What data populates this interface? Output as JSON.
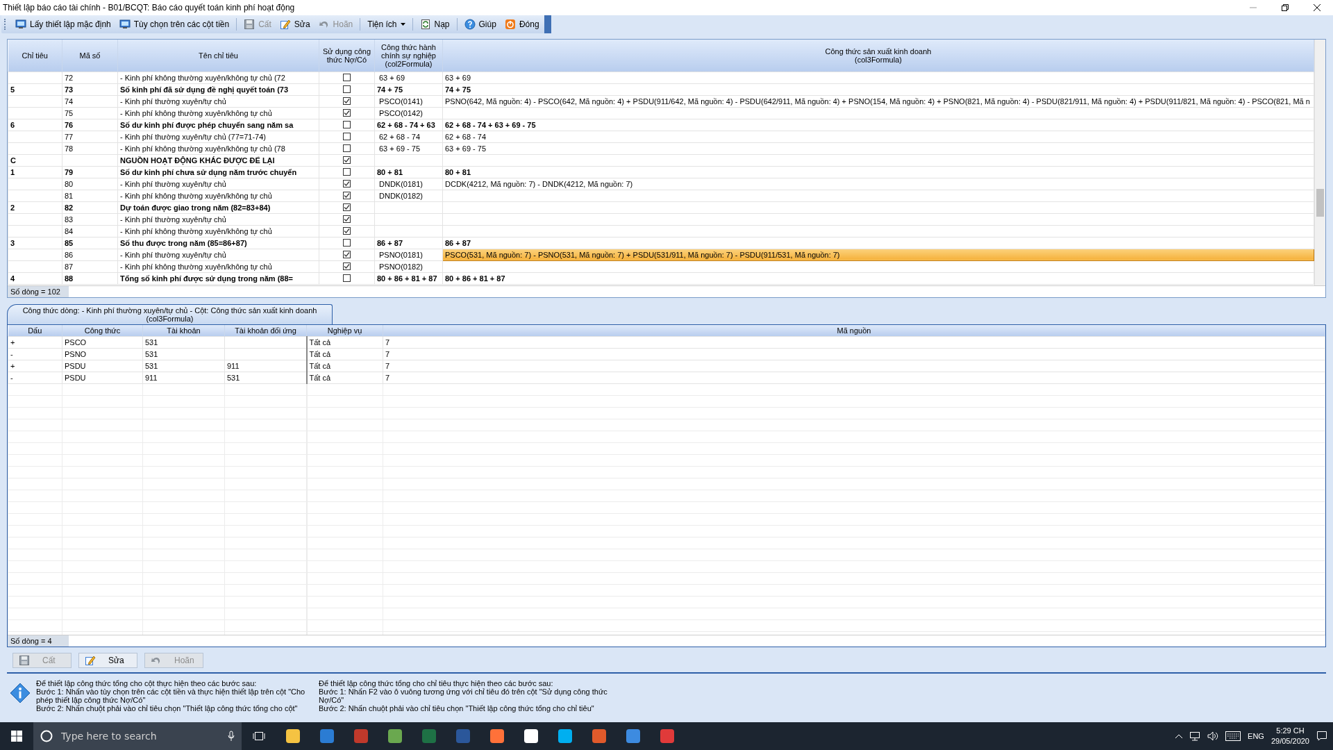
{
  "window": {
    "title": "Thiết lập báo cáo tài chính - B01/BCQT: Báo cáo quyết toán kinh phí hoạt động"
  },
  "toolbar": [
    {
      "label": "Lấy thiết lập mặc định",
      "kind": "button",
      "disabled": false,
      "separator_before": false
    },
    {
      "label": "Tùy chọn trên các cột tiền",
      "kind": "button",
      "disabled": false,
      "separator_before": false
    },
    {
      "label": "Cất",
      "kind": "button",
      "disabled": true,
      "separator_before": true
    },
    {
      "label": "Sửa",
      "kind": "button",
      "disabled": false,
      "separator_before": false
    },
    {
      "label": "Hoãn",
      "kind": "button",
      "disabled": true,
      "separator_before": false
    },
    {
      "label": "Tiện ích",
      "kind": "dropdown",
      "disabled": false,
      "separator_before": true
    },
    {
      "label": "Nạp",
      "kind": "button",
      "disabled": false,
      "separator_before": true
    },
    {
      "label": "Giúp",
      "kind": "button",
      "disabled": false,
      "separator_before": true
    },
    {
      "label": "Đóng",
      "kind": "button",
      "disabled": false,
      "separator_before": false
    }
  ],
  "indicator_grid": {
    "columns": [
      "Chỉ tiêu",
      "Mã số",
      "Tên chỉ tiêu",
      "Sử dụng công thức Nợ/Có",
      "Công thức hành chính sự nghiệp (col2Formula)",
      "Công thức sản xuất kinh doanh (col3Formula)"
    ],
    "rows": [
      {
        "chi_tieu": "",
        "ma_so": "72",
        "ten": "- Kinh phí không thường xuyên/không tự chủ (72",
        "checked": false,
        "bold": false,
        "col2": "63 + 69",
        "col3": "63 + 69",
        "selected": false
      },
      {
        "chi_tieu": "5",
        "ma_so": "73",
        "ten": "Số kinh phí đã sử dụng đề nghị quyết toán (73",
        "checked": false,
        "bold": true,
        "col2": "74 + 75",
        "col3": "74 + 75",
        "selected": false
      },
      {
        "chi_tieu": "",
        "ma_so": "74",
        "ten": "- Kinh phí thường xuyên/tự chủ",
        "checked": true,
        "bold": false,
        "col2": "PSCO(0141)",
        "col3": "PSNO(642, Mã nguồn: 4) - PSCO(642, Mã nguồn: 4) + PSDU(911/642, Mã nguồn: 4) - PSDU(642/911, Mã nguồn: 4) + PSNO(154, Mã nguồn: 4) + PSNO(821, Mã nguồn: 4) - PSDU(821/911, Mã nguồn: 4) + PSDU(911/821, Mã nguồn: 4) - PSCO(821, Mã n",
        "selected": false
      },
      {
        "chi_tieu": "",
        "ma_so": "75",
        "ten": "- Kinh phí không thường xuyên/không tự chủ",
        "checked": true,
        "bold": false,
        "col2": "PSCO(0142)",
        "col3": "",
        "selected": false
      },
      {
        "chi_tieu": "6",
        "ma_so": "76",
        "ten": "Số dư kinh phí được phép chuyển sang năm sa",
        "checked": false,
        "bold": true,
        "col2": "62 + 68 - 74 + 63",
        "col3": "62 + 68 - 74 + 63 + 69 - 75",
        "selected": false
      },
      {
        "chi_tieu": "",
        "ma_so": "77",
        "ten": "- Kinh phí thường xuyên/tự chủ (77=71-74)",
        "checked": false,
        "bold": false,
        "col2": "62 + 68 - 74",
        "col3": "62 + 68 - 74",
        "selected": false
      },
      {
        "chi_tieu": "",
        "ma_so": "78",
        "ten": "- Kinh phí không thường xuyên/không tự chủ (78",
        "checked": false,
        "bold": false,
        "col2": "63 + 69 - 75",
        "col3": "63 + 69 - 75",
        "selected": false
      },
      {
        "chi_tieu": "C",
        "ma_so": "",
        "ten": "NGUỒN HOẠT ĐỘNG KHÁC ĐƯỢC ĐỂ LẠI",
        "checked": true,
        "bold": true,
        "col2": "",
        "col3": "",
        "selected": false
      },
      {
        "chi_tieu": "1",
        "ma_so": "79",
        "ten": "Số dư kinh phí chưa sử dụng năm trước chuyển",
        "checked": false,
        "bold": true,
        "col2": "80 + 81",
        "col3": "80 + 81",
        "selected": false
      },
      {
        "chi_tieu": "",
        "ma_so": "80",
        "ten": "- Kinh phí thường xuyên/tự chủ",
        "checked": true,
        "bold": false,
        "col2": "DNDK(0181)",
        "col3": "DCDK(4212, Mã nguồn: 7) - DNDK(4212, Mã nguồn: 7)",
        "selected": false
      },
      {
        "chi_tieu": "",
        "ma_so": "81",
        "ten": "- Kinh phí không thường xuyên/không tự chủ",
        "checked": true,
        "bold": false,
        "col2": "DNDK(0182)",
        "col3": "",
        "selected": false
      },
      {
        "chi_tieu": "2",
        "ma_so": "82",
        "ten": "Dự toán được giao trong năm (82=83+84)",
        "checked": true,
        "bold": true,
        "col2": "",
        "col3": "",
        "selected": false
      },
      {
        "chi_tieu": "",
        "ma_so": "83",
        "ten": "- Kinh phí thường xuyên/tự chủ",
        "checked": true,
        "bold": false,
        "col2": "",
        "col3": "",
        "selected": false
      },
      {
        "chi_tieu": "",
        "ma_so": "84",
        "ten": "- Kinh phí không thường xuyên/không tự chủ",
        "checked": true,
        "bold": false,
        "col2": "",
        "col3": "",
        "selected": false
      },
      {
        "chi_tieu": "3",
        "ma_so": "85",
        "ten": "Số thu được trong năm (85=86+87)",
        "checked": false,
        "bold": true,
        "col2": "86 + 87",
        "col3": "86 + 87",
        "selected": false
      },
      {
        "chi_tieu": "",
        "ma_so": "86",
        "ten": "- Kinh phí thường xuyên/tự chủ",
        "checked": true,
        "bold": false,
        "col2": "PSNO(0181)",
        "col3": "PSCO(531, Mã nguồn: 7) - PSNO(531, Mã nguồn: 7) + PSDU(531/911, Mã nguồn: 7) - PSDU(911/531, Mã nguồn: 7)",
        "selected": true
      },
      {
        "chi_tieu": "",
        "ma_so": "87",
        "ten": "- Kinh phí không thường xuyên/không tự chủ",
        "checked": true,
        "bold": false,
        "col2": "PSNO(0182)",
        "col3": "",
        "selected": false
      },
      {
        "chi_tieu": "4",
        "ma_so": "88",
        "ten": "Tổng số kinh phí được sử dụng trong năm (88=",
        "checked": false,
        "bold": true,
        "col2": "80 + 86 + 81 + 87",
        "col3": "80 + 86 + 81 + 87",
        "selected": false
      }
    ],
    "row_count": "Số dòng = 102"
  },
  "formula_tab": {
    "label": "Công thức dòng: - Kinh phí thường xuyên/tự chủ - Cột: Công thức sản xuất kinh doanh (col3Formula)",
    "selected": true
  },
  "formula_grid": {
    "columns": [
      "Dấu",
      "Công thức",
      "Tài khoản",
      "Tài khoản đối ứng",
      "Nghiệp vụ",
      "Mã nguồn"
    ],
    "rows": [
      {
        "sign": "+",
        "formula": "PSCO",
        "account": "531",
        "counter_account": "",
        "operation": "Tất cả",
        "source": "7"
      },
      {
        "sign": "-",
        "formula": "PSNO",
        "account": "531",
        "counter_account": "",
        "operation": "Tất cả",
        "source": "7"
      },
      {
        "sign": "+",
        "formula": "PSDU",
        "account": "531",
        "counter_account": "911",
        "operation": "Tất cả",
        "source": "7"
      },
      {
        "sign": "-",
        "formula": "PSDU",
        "account": "911",
        "counter_account": "531",
        "operation": "Tất cả",
        "source": "7"
      }
    ],
    "row_count": "Số dòng = 4"
  },
  "buttons": [
    {
      "label": "Cất",
      "disabled": true
    },
    {
      "label": "Sửa",
      "disabled": false
    },
    {
      "label": "Hoãn",
      "disabled": true
    }
  ],
  "help": [
    {
      "lines": [
        "Để thiết lập công thức tổng cho cột thực hiện theo các bước sau:",
        "Bước 1: Nhấn vào tùy chọn trên các cột tiền và thực hiện thiết lập trên cột \"Cho phép thiết lập công thức Nợ/Có\"",
        "Bước 2: Nhấn chuột phải vào chỉ tiêu chọn \"Thiết lập công thức tổng cho cột\""
      ]
    },
    {
      "lines": [
        "Để thiết lập công thức tổng cho chỉ tiêu thực hiện theo các bước sau:",
        "Bước 1: Nhấn F2 vào ô vuông tương ứng với chỉ tiêu đó trên cột \"Sử dụng công thức Nợ/Có\"",
        "Bước 2: Nhấn chuột phải vào chỉ tiêu chọn \"Thiết lập công thức tổng cho chỉ tiêu\""
      ]
    }
  ],
  "taskbar": {
    "search": {
      "placeholder": "Type here to search"
    },
    "language": "ENG",
    "time": "5:29 CH",
    "date": "29/05/2020"
  }
}
